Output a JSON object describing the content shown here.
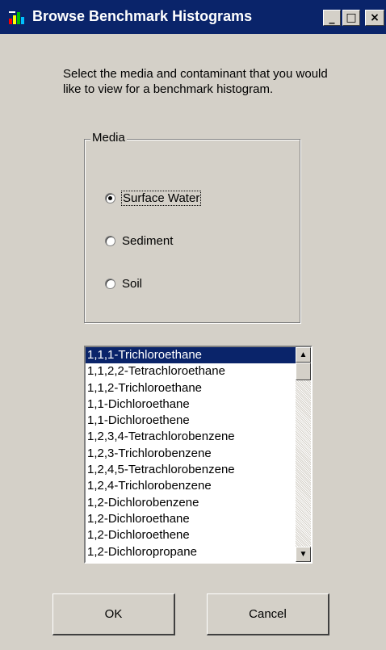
{
  "window": {
    "title": "Browse Benchmark Histograms",
    "minimize_glyph": "_",
    "maximize_glyph": "□",
    "close_glyph": "×",
    "accent": "#0a246a"
  },
  "instructions": "Select the media and contaminant that you would like to view for a benchmark histogram.",
  "media": {
    "label": "Media",
    "options": [
      {
        "label": "Surface Water",
        "selected": true
      },
      {
        "label": "Sediment",
        "selected": false
      },
      {
        "label": "Soil",
        "selected": false
      }
    ]
  },
  "contaminants": {
    "selected_index": 0,
    "items": [
      "1,1,1-Trichloroethane",
      "1,1,2,2-Tetrachloroethane",
      "1,1,2-Trichloroethane",
      "1,1-Dichloroethane",
      "1,1-Dichloroethene",
      "1,2,3,4-Tetrachlorobenzene",
      "1,2,3-Trichlorobenzene",
      "1,2,4,5-Tetrachlorobenzene",
      "1,2,4-Trichlorobenzene",
      "1,2-Dichlorobenzene",
      "1,2-Dichloroethane",
      "1,2-Dichloroethene",
      "1,2-Dichloropropane"
    ]
  },
  "buttons": {
    "ok": "OK",
    "cancel": "Cancel"
  }
}
